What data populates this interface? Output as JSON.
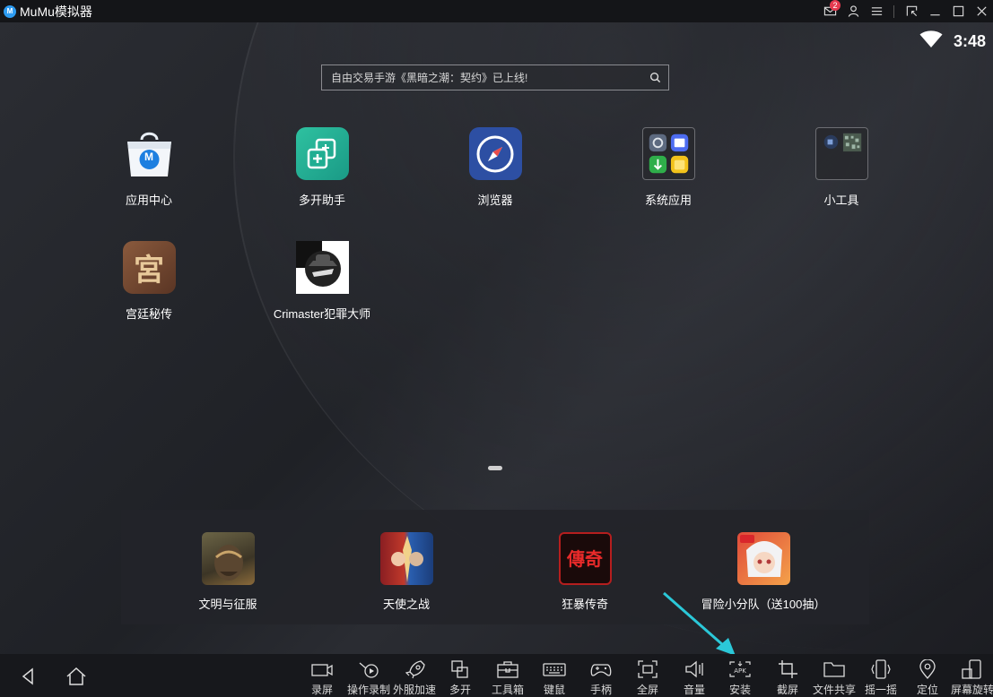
{
  "window": {
    "title": "MuMu模拟器",
    "logo_text": "M",
    "notification_count": "2"
  },
  "status": {
    "time": "3:48"
  },
  "search": {
    "text": "自由交易手游《黑暗之潮：契约》已上线!"
  },
  "desktop": {
    "apps": [
      {
        "label": "应用中心",
        "icon": "app-center-icon"
      },
      {
        "label": "多开助手",
        "icon": "multi-instance-icon"
      },
      {
        "label": "浏览器",
        "icon": "browser-compass-icon"
      },
      {
        "label": "系统应用",
        "icon": "system-apps-folder-icon"
      },
      {
        "label": "小工具",
        "icon": "tools-folder-icon"
      },
      {
        "label": "宫廷秘传",
        "icon": "game-icon"
      },
      {
        "label": "Crimaster犯罪大师",
        "icon": "game-icon"
      }
    ],
    "app_center_glyph": "M",
    "palace_glyph": "宮"
  },
  "dock": {
    "apps": [
      {
        "label": "文明与征服"
      },
      {
        "label": "天使之战"
      },
      {
        "label": "狂暴传奇",
        "glyph": "傳奇"
      },
      {
        "label": "冒险小分队（送100抽）"
      }
    ]
  },
  "toolbar": {
    "items": [
      {
        "label": "录屏",
        "icon": "video-record-icon"
      },
      {
        "label": "操作录制",
        "icon": "macro-record-icon"
      },
      {
        "label": "外服加速",
        "icon": "rocket-icon"
      },
      {
        "label": "多开",
        "icon": "multi-window-icon"
      },
      {
        "label": "工具箱",
        "icon": "toolbox-icon"
      },
      {
        "label": "键鼠",
        "icon": "keyboard-icon"
      },
      {
        "label": "手柄",
        "icon": "gamepad-icon"
      },
      {
        "label": "全屏",
        "icon": "fullscreen-icon"
      },
      {
        "label": "音量",
        "icon": "volume-icon"
      },
      {
        "label": "安装",
        "icon": "apk-install-icon"
      },
      {
        "label": "截屏",
        "icon": "crop-icon"
      },
      {
        "label": "文件共享",
        "icon": "folder-icon"
      },
      {
        "label": "摇一摇",
        "icon": "shake-icon"
      },
      {
        "label": "定位",
        "icon": "location-icon"
      },
      {
        "label": "屏幕旋转",
        "icon": "rotate-icon"
      }
    ]
  },
  "colors": {
    "accent": "#2d9bf0",
    "annotation_arrow": "#2bc8d8",
    "badge": "#e53a4f"
  }
}
